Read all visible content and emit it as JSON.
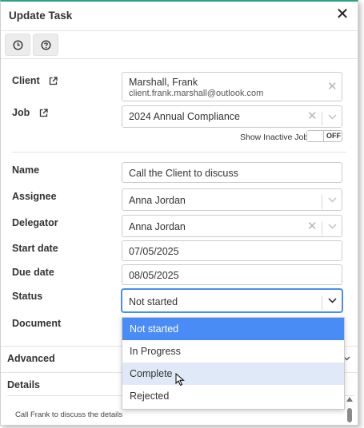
{
  "dialog": {
    "title": "Update Task"
  },
  "toolbar": {
    "icons": [
      "clock-icon",
      "help-icon"
    ]
  },
  "client": {
    "label": "Client",
    "name": "Marshall, Frank",
    "email": "client.frank.marshall@outlook.com"
  },
  "job": {
    "label": "Job",
    "value": "2024 Annual Compliance"
  },
  "inactive": {
    "label": "Show Inactive Jobs",
    "state": "OFF"
  },
  "name": {
    "label": "Name",
    "value": "Call the Client to discuss"
  },
  "assignee": {
    "label": "Assignee",
    "value": "Anna Jordan"
  },
  "delegator": {
    "label": "Delegator",
    "value": "Anna Jordan"
  },
  "start_date": {
    "label": "Start date",
    "value": "07/05/2025"
  },
  "due_date": {
    "label": "Due date",
    "value": "08/05/2025"
  },
  "status": {
    "label": "Status",
    "value": "Not started",
    "options": [
      "Not started",
      "In Progress",
      "Complete",
      "Rejected"
    ],
    "highlighted": "Not started",
    "hovered": "Complete"
  },
  "document": {
    "label": "Document"
  },
  "advanced": {
    "label": "Advanced"
  },
  "details": {
    "label": "Details",
    "text": "Call Frank to discuss the details"
  },
  "colors": {
    "accent": "#4a8cf6",
    "hover": "#dfe9f8",
    "header_line": "#2f9e8a"
  }
}
